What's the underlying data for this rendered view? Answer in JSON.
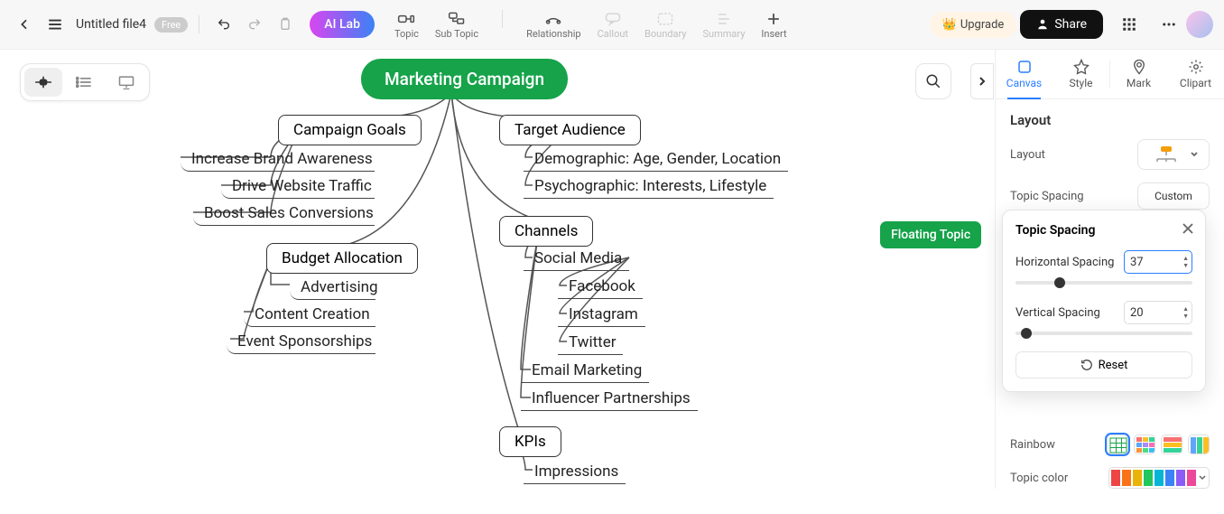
{
  "header": {
    "filename": "Untitled file4",
    "free_badge": "Free",
    "ailab": "AI Lab",
    "upgrade": "Upgrade",
    "share": "Share",
    "tools": {
      "topic": "Topic",
      "subtopic": "Sub Topic",
      "relationship": "Relationship",
      "callout": "Callout",
      "boundary": "Boundary",
      "summary": "Summary",
      "insert": "Insert"
    }
  },
  "mindmap": {
    "root": "Marketing Campaign",
    "left": [
      {
        "title": "Campaign Goals",
        "children": [
          "Increase Brand Awareness",
          "Drive Website Traffic",
          "Boost Sales Conversions"
        ]
      },
      {
        "title": "Budget Allocation",
        "children": [
          "Advertising",
          "Content Creation",
          "Event Sponsorships"
        ]
      }
    ],
    "right": [
      {
        "title": "Target Audience",
        "children": [
          "Demographic: Age, Gender, Location",
          "Psychographic: Interests, Lifestyle"
        ]
      },
      {
        "title": "Channels",
        "children": [
          {
            "label": "Social Media",
            "children": [
              "Facebook",
              "Instagram",
              "Twitter"
            ]
          },
          {
            "label": "Email Marketing"
          },
          {
            "label": "Influencer Partnerships"
          }
        ]
      },
      {
        "title": "KPIs",
        "children": [
          "Impressions"
        ]
      }
    ],
    "floating": "Floating Topic"
  },
  "right_panel": {
    "tabs": {
      "canvas": "Canvas",
      "style": "Style",
      "mark": "Mark",
      "clipart": "Clipart"
    },
    "section_title": "Layout",
    "layout_label": "Layout",
    "topic_spacing_label": "Topic Spacing",
    "custom": "Custom",
    "rainbow": "Rainbow",
    "topic_color": "Topic color"
  },
  "popover": {
    "title": "Topic Spacing",
    "horizontal_label": "Horizontal Spacing",
    "horizontal_value": "37",
    "vertical_label": "Vertical Spacing",
    "vertical_value": "20",
    "reset": "Reset"
  }
}
